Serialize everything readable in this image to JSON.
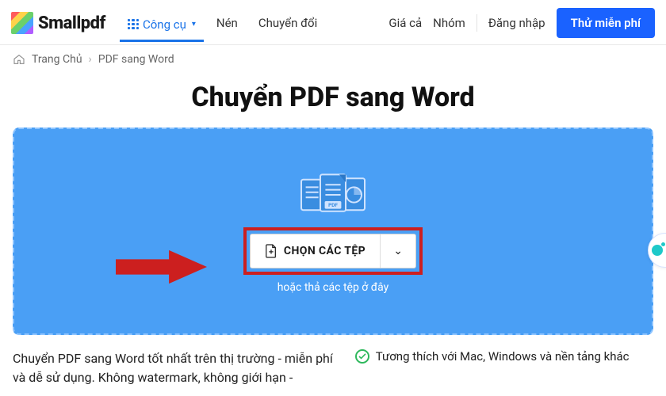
{
  "brand": "Smallpdf",
  "nav": {
    "tools": "Công cụ",
    "compress": "Nén",
    "convert": "Chuyển đổi",
    "pricing": "Giá cả",
    "teams": "Nhóm",
    "login": "Đăng nhập",
    "trial": "Thử miễn phí"
  },
  "breadcrumb": {
    "home": "Trang Chủ",
    "current": "PDF sang Word"
  },
  "page": {
    "title": "Chuyển PDF sang Word",
    "choose_label": "CHỌN CÁC TỆP",
    "drop_hint": "hoặc thả các tệp ở đây"
  },
  "below": {
    "desc": "Chuyển PDF sang Word tốt nhất trên thị trường - miễn phí và dễ sử dụng. Không watermark, không giới hạn -",
    "feat1": "Tương thích với Mac, Windows và nền tảng khác"
  }
}
